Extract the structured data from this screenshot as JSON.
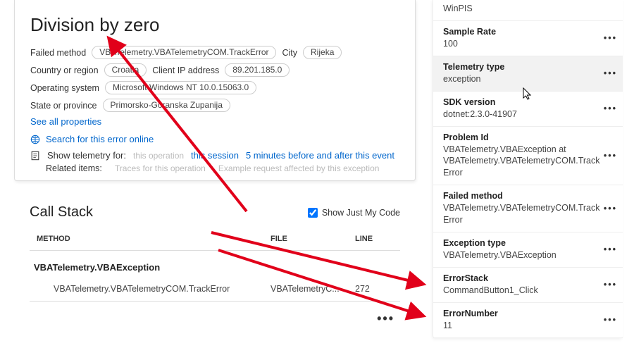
{
  "error": {
    "title": "Division by zero",
    "failedMethodLabel": "Failed method",
    "failedMethodValue": "VBATelemetry.VBATelemetryCOM.TrackError",
    "cityLabel": "City",
    "cityValue": "Rijeka",
    "countryLabel": "Country or region",
    "countryValue": "Croatia",
    "ipLabel": "Client IP address",
    "ipValue": "89.201.185.0",
    "osLabel": "Operating system",
    "osValue": "Microsoft Windows NT 10.0.15063.0",
    "stateLabel": "State or province",
    "stateValue": "Primorsko-Goranska Zupanija",
    "seeAll": "See all properties",
    "searchOnline": "Search for this error online",
    "showTelemetry": "Show telemetry for:",
    "thisOpFaded": "this operation",
    "thisSession": "this session",
    "timeWindow": "5 minutes before and after this event",
    "relatedItems": "Related items:",
    "relatedFaded1": "Traces for this operation",
    "relatedFaded2": "Example request affected by this exception"
  },
  "callstack": {
    "title": "Call Stack",
    "showJustMyCode": "Show Just My Code",
    "colMethod": "METHOD",
    "colFile": "FILE",
    "colLine": "LINE",
    "row1": "VBATelemetry.VBAException",
    "row2Method": "VBATelemetry.VBATelemetryCOM.TrackError",
    "row2File": "VBATelemetryC...",
    "row2Line": "272"
  },
  "side": {
    "winpis": "WinPIS",
    "sampleRateKey": "Sample Rate",
    "sampleRateVal": "100",
    "telemetryTypeKey": "Telemetry type",
    "telemetryTypeVal": "exception",
    "sdkKey": "SDK version",
    "sdkVal": "dotnet:2.3.0-41907",
    "problemIdKey": "Problem Id",
    "problemIdVal": "VBATelemetry.VBAException at VBATelemetry.VBATelemetryCOM.TrackError",
    "failedMethodKey": "Failed method",
    "failedMethodVal": "VBATelemetry.VBATelemetryCOM.TrackError",
    "exceptionTypeKey": "Exception type",
    "exceptionTypeVal": "VBATelemetry.VBAException",
    "errorStackKey": "ErrorStack",
    "errorStackVal": "CommandButton1_Click",
    "errorNumberKey": "ErrorNumber",
    "errorNumberVal": "11"
  }
}
